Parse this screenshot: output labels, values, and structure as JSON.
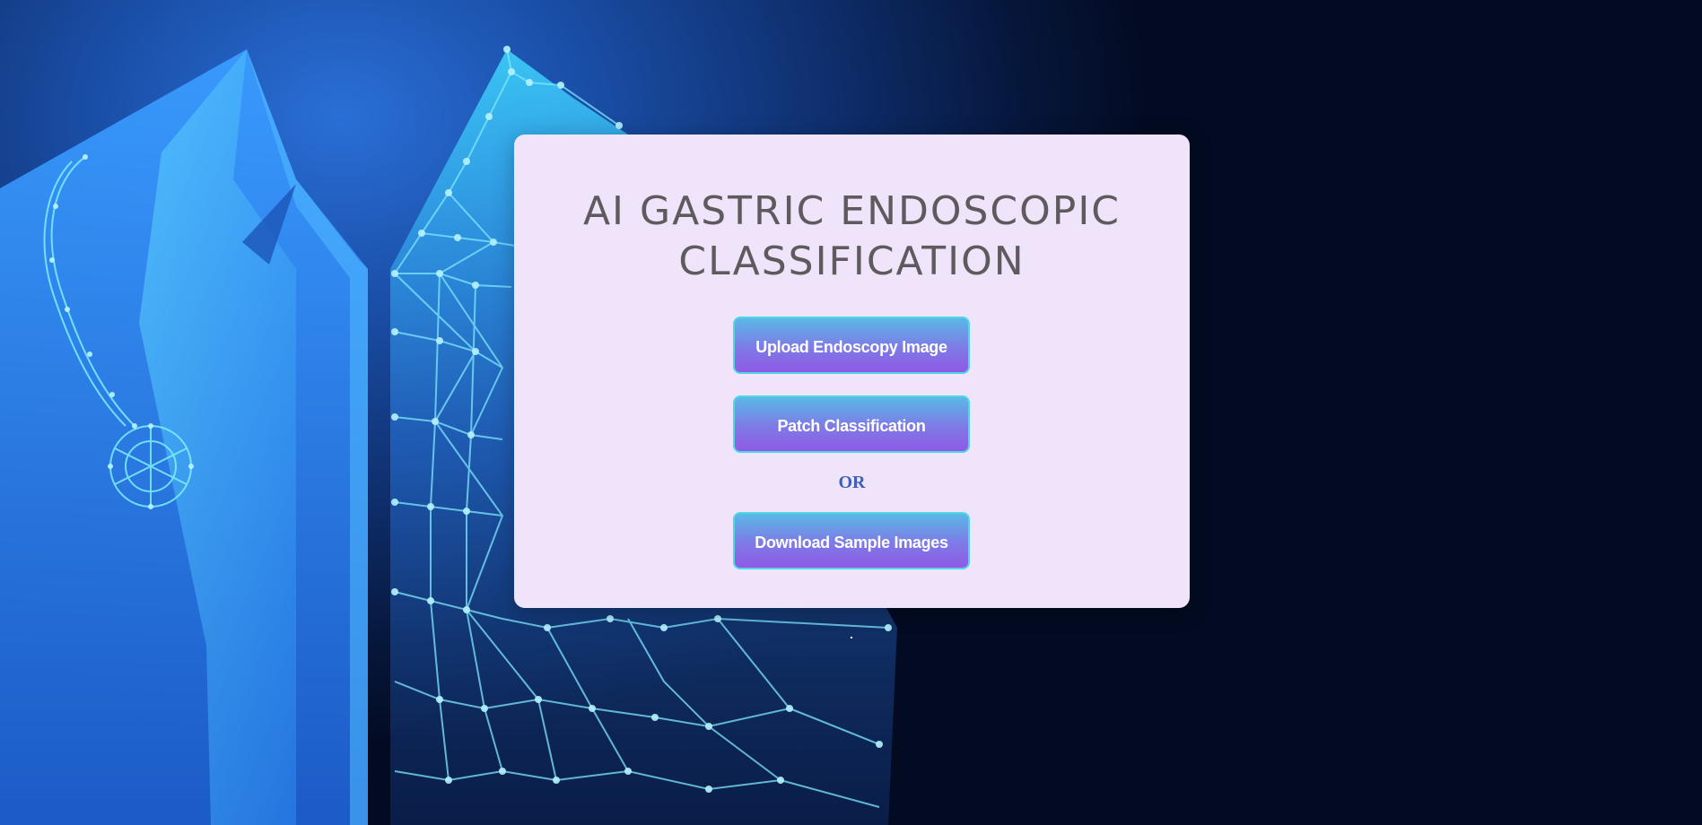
{
  "page": {
    "title": "AI GASTRIC ENDOSCOPIC CLASSIFICATION",
    "background_image": "doctor-coat-network-illustration"
  },
  "card": {
    "title_line1": "AI GASTRIC ENDOSCOPIC",
    "title_line2": "CLASSIFICATION",
    "buttons": {
      "upload_label": "Upload Endoscopy Image",
      "patch_label": "Patch Classification",
      "download_label": "Download Sample Images"
    },
    "or_text": "OR"
  },
  "colors": {
    "card_bg": "#f0e4fb",
    "title_color": "#5f5a5e",
    "button_gradient_top": "#5ab8e6",
    "button_gradient_bottom": "#8f5ae6",
    "button_border": "#4fd6e8",
    "or_color": "#3f5fb8"
  }
}
